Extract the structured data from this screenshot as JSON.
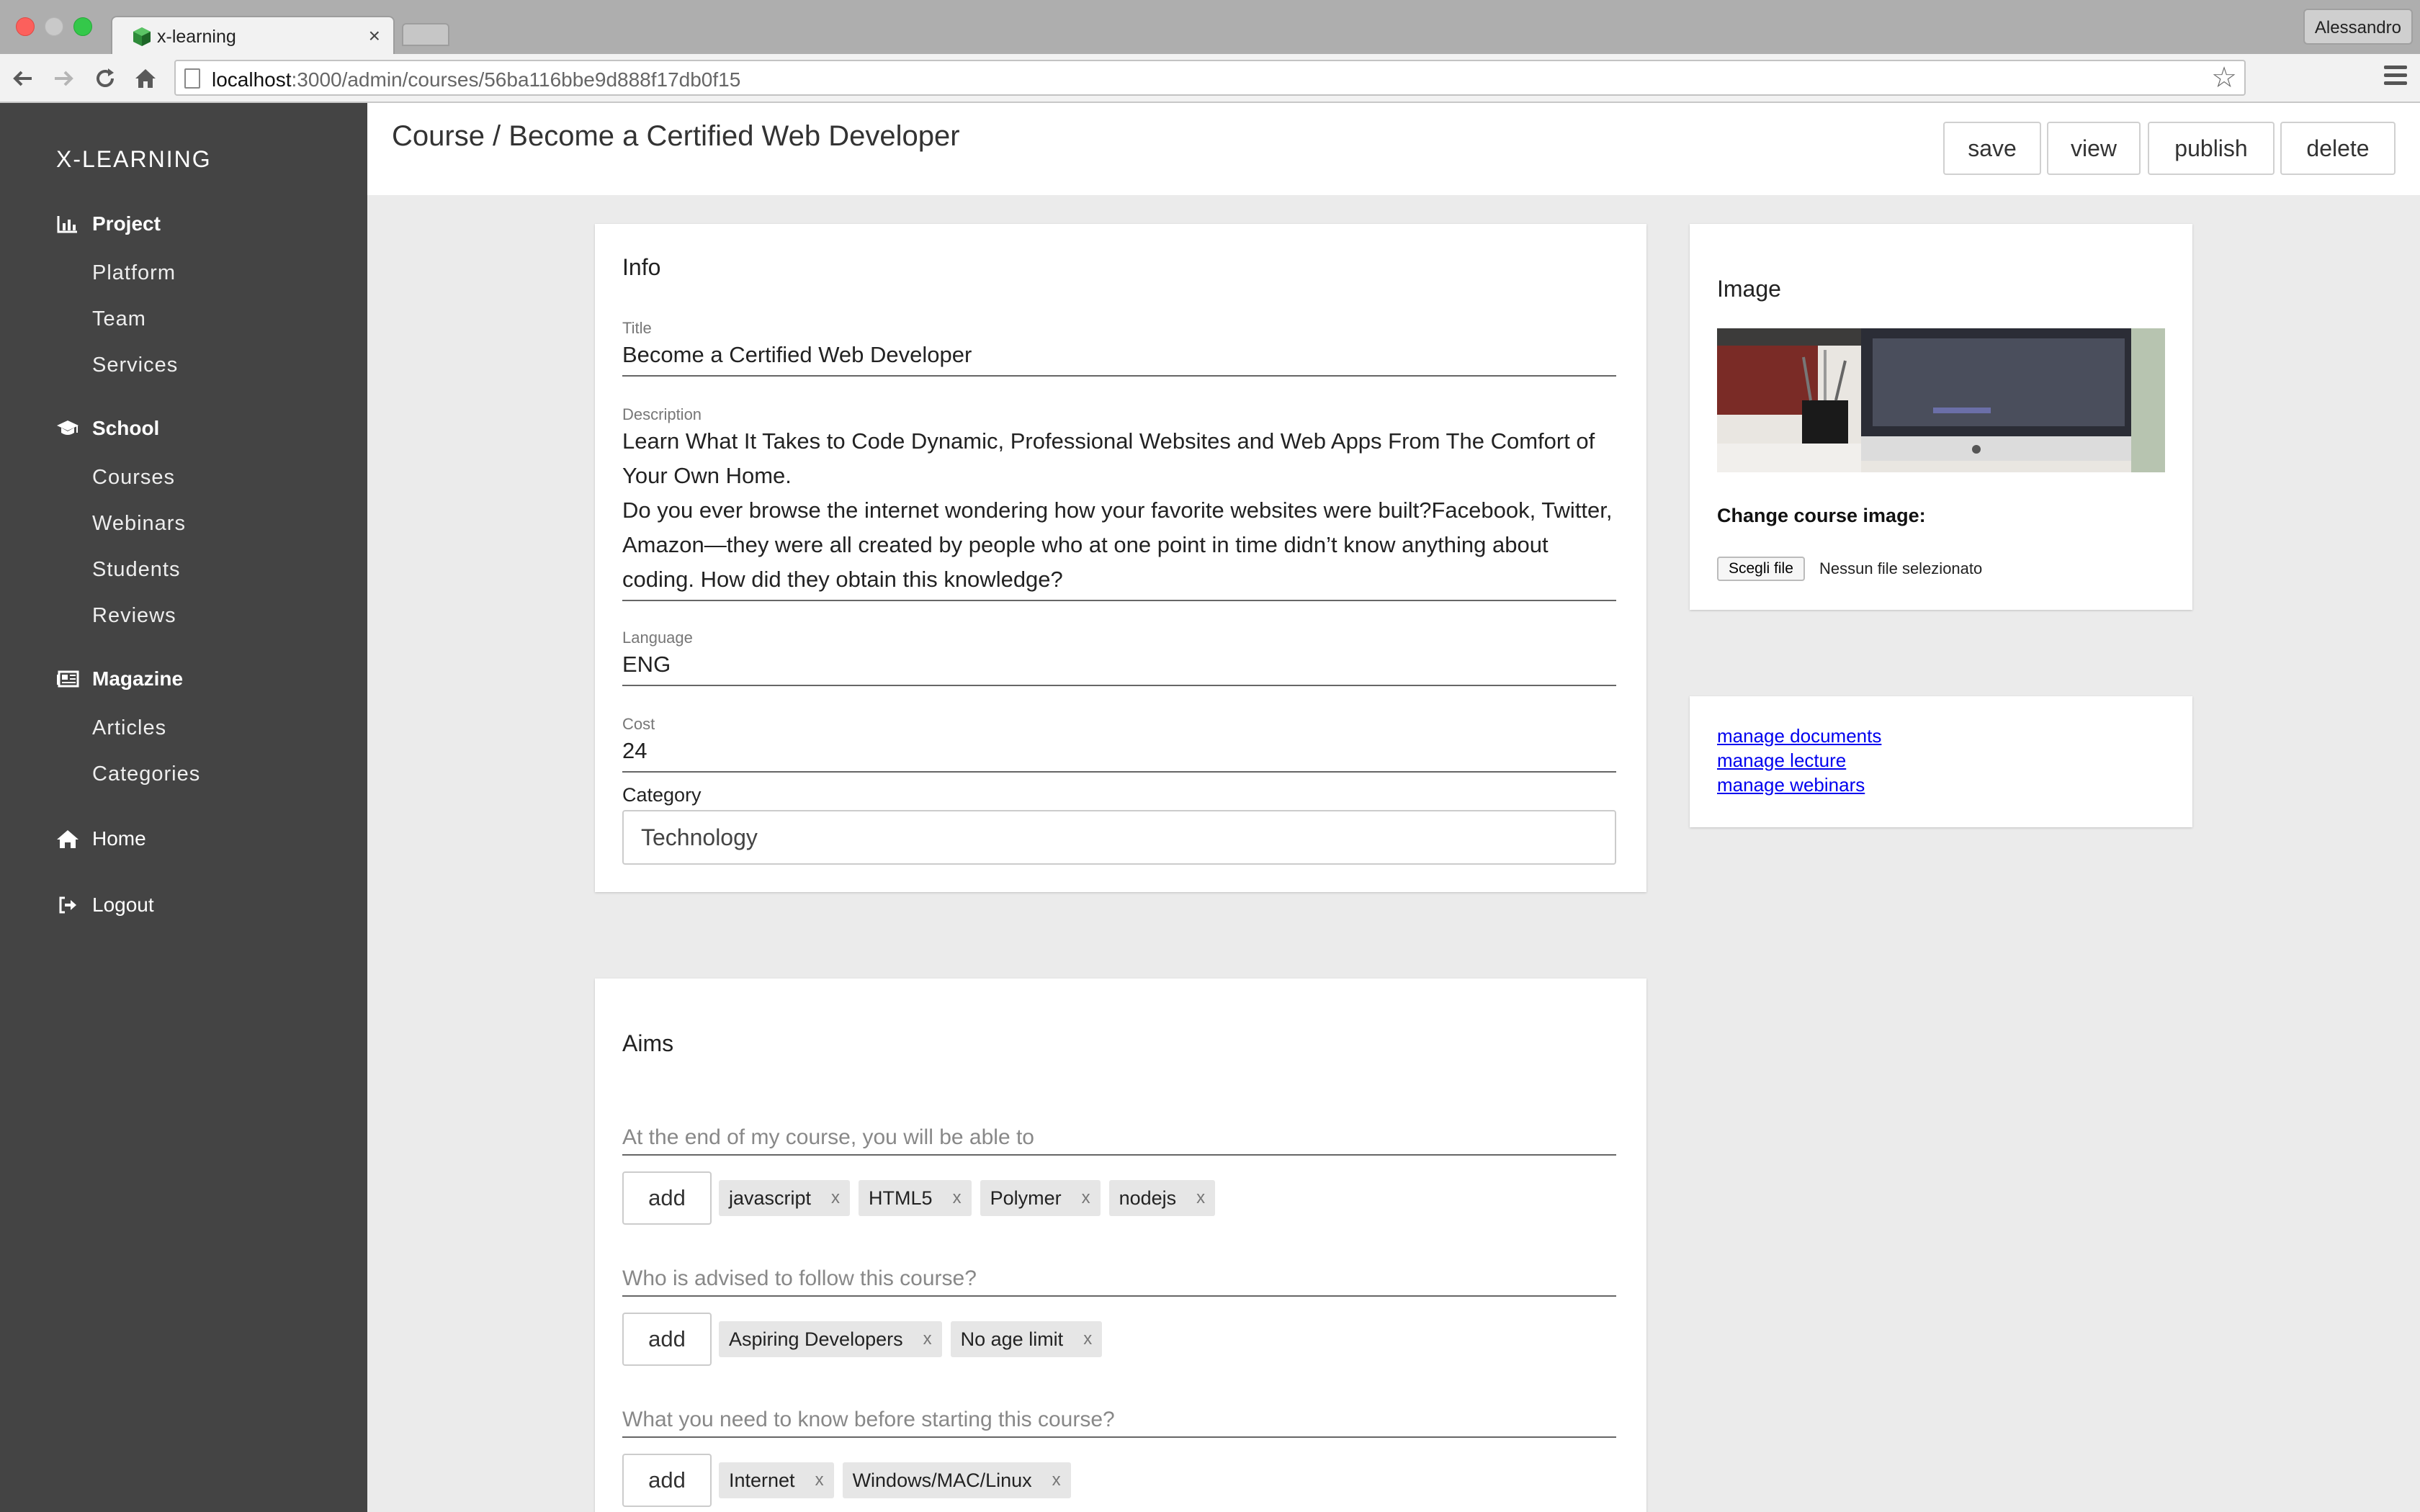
{
  "browser": {
    "tab_title": "x-learning",
    "tab_close": "×",
    "profile_name": "Alessandro",
    "url_host": "localhost",
    "url_path": ":3000/admin/courses/56ba116bbe9d888f17db0f15"
  },
  "sidebar": {
    "brand": "X-LEARNING",
    "sections": {
      "project": {
        "label": "Project",
        "icon": "bar-chart-icon",
        "items": [
          "Platform",
          "Team",
          "Services"
        ]
      },
      "school": {
        "label": "School",
        "icon": "graduation-cap-icon",
        "items": [
          "Courses",
          "Webinars",
          "Students",
          "Reviews"
        ]
      },
      "magazine": {
        "label": "Magazine",
        "icon": "newspaper-icon",
        "items": [
          "Articles",
          "Categories"
        ]
      }
    },
    "home": "Home",
    "logout": "Logout"
  },
  "header": {
    "title": "Course / Become a Certified Web Developer",
    "buttons": {
      "save": "save",
      "view": "view",
      "publish": "publish",
      "delete": "delete"
    }
  },
  "info": {
    "heading": "Info",
    "title_label": "Title",
    "title_value": "Become a Certified Web Developer",
    "description_label": "Description",
    "description_value": "Learn What It Takes to Code Dynamic, Professional Websites and Web Apps From The Comfort of Your Own Home.\nDo you ever browse the internet wondering how your favorite websites were built?Facebook, Twitter, Amazon—they were all created by people who at one point in time didn’t know anything about coding. How did they obtain this knowledge?",
    "language_label": "Language",
    "language_value": "ENG",
    "cost_label": "Cost",
    "cost_value": "24",
    "category_label": "Category",
    "category_value": "Technology"
  },
  "image_card": {
    "heading": "Image",
    "change_label": "Change course image:",
    "file_button": "Scegli file",
    "file_status": "Nessun file selezionato"
  },
  "links": {
    "documents": "manage documents",
    "lecture": "manage lecture",
    "webinars": "manage webinars"
  },
  "aims": {
    "heading": "Aims",
    "add_label": "add",
    "chip_remove": "x",
    "groups": [
      {
        "question": "At the end of my course, you will be able to",
        "tags": [
          "javascript",
          "HTML5",
          "Polymer",
          "nodejs"
        ]
      },
      {
        "question": "Who is advised to follow this course?",
        "tags": [
          "Aspiring Developers",
          "No age limit"
        ]
      },
      {
        "question": "What you need to know before starting this course?",
        "tags": [
          "Internet",
          "Windows/MAC/Linux"
        ]
      }
    ]
  },
  "colors": {
    "sidebar_bg": "#444444",
    "page_bg": "#ebebeb",
    "card_bg": "#ffffff",
    "link": "#0000ee"
  }
}
